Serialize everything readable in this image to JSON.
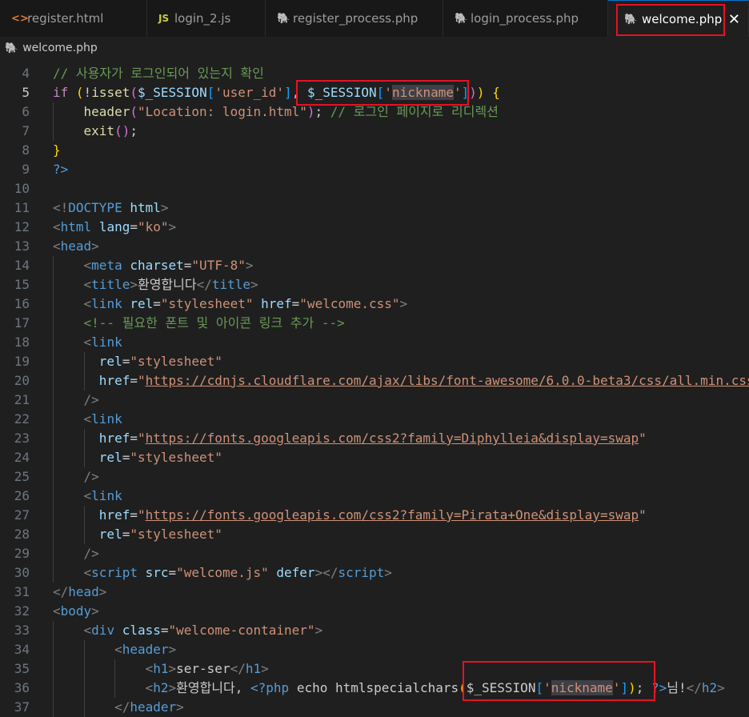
{
  "tabs": [
    {
      "label": "register.html",
      "icon": "html-file-icon",
      "icon_glyph": "<>",
      "icon_color": "#e37933",
      "active": false
    },
    {
      "label": "login_2.js",
      "icon": "js-file-icon",
      "icon_glyph": "JS",
      "icon_color": "#cbcb41",
      "active": false
    },
    {
      "label": "register_process.php",
      "icon": "php-elephant-icon",
      "icon_glyph": "🐘",
      "icon_color": "#a074c4",
      "active": false
    },
    {
      "label": "login_process.php",
      "icon": "php-elephant-icon",
      "icon_glyph": "🐘",
      "icon_color": "#a074c4",
      "active": false
    },
    {
      "label": "welcome.php",
      "icon": "php-elephant-icon",
      "icon_glyph": "🐘",
      "icon_color": "#a074c4",
      "active": true,
      "close": "✕"
    }
  ],
  "breadcrumb": {
    "icon": "php-elephant-icon",
    "icon_glyph": "🐘",
    "file": "welcome.php"
  },
  "editor": {
    "active_line": 5,
    "lines": [
      {
        "n": "4",
        "tokens": [
          [
            "// 사용자가 로그인되어 있는지 확인",
            "cmt"
          ]
        ]
      },
      {
        "n": "5",
        "tokens": [
          [
            "if",
            "kw"
          ],
          [
            " ",
            "txt"
          ],
          [
            "(",
            "b1"
          ],
          [
            "!",
            "txt"
          ],
          [
            "isset",
            "fn"
          ],
          [
            "(",
            "b2"
          ],
          [
            "$_SESSION",
            "var"
          ],
          [
            "[",
            "b3"
          ],
          [
            "'user_id'",
            "str"
          ],
          [
            "]",
            "b3"
          ],
          [
            ", ",
            "txt"
          ],
          [
            "$_SESSION",
            "var"
          ],
          [
            "[",
            "b3"
          ],
          [
            "'",
            "str"
          ],
          [
            "nickname",
            "str-sel"
          ],
          [
            "'",
            "str"
          ],
          [
            "]",
            "b3"
          ],
          [
            ")",
            "b2"
          ],
          [
            ")",
            "b1"
          ],
          [
            " ",
            "txt"
          ],
          [
            "{",
            "b1"
          ]
        ]
      },
      {
        "n": "6",
        "tokens": [
          [
            "    ",
            "txt"
          ],
          [
            "header",
            "fn"
          ],
          [
            "(",
            "b2"
          ],
          [
            "\"Location: login.html\"",
            "str"
          ],
          [
            ")",
            "b2"
          ],
          [
            "; ",
            "txt"
          ],
          [
            "// 로그인 페이지로 리디렉션",
            "cmt"
          ]
        ]
      },
      {
        "n": "7",
        "tokens": [
          [
            "    ",
            "txt"
          ],
          [
            "exit",
            "fn"
          ],
          [
            "()",
            "b2"
          ],
          [
            ";",
            "txt"
          ]
        ]
      },
      {
        "n": "8",
        "tokens": [
          [
            "}",
            "b1"
          ]
        ]
      },
      {
        "n": "9",
        "tokens": [
          [
            "?>",
            "tag"
          ]
        ]
      },
      {
        "n": "10",
        "tokens": []
      },
      {
        "n": "11",
        "tokens": [
          [
            "<!",
            "pun"
          ],
          [
            "DOCTYPE",
            "tag"
          ],
          [
            " ",
            "txt"
          ],
          [
            "html",
            "attr"
          ],
          [
            ">",
            "pun"
          ]
        ]
      },
      {
        "n": "12",
        "tokens": [
          [
            "<",
            "pun"
          ],
          [
            "html",
            "tag"
          ],
          [
            " ",
            "txt"
          ],
          [
            "lang",
            "attr"
          ],
          [
            "=",
            "txt"
          ],
          [
            "\"ko\"",
            "str"
          ],
          [
            ">",
            "pun"
          ]
        ]
      },
      {
        "n": "13",
        "tokens": [
          [
            "<",
            "pun"
          ],
          [
            "head",
            "tag"
          ],
          [
            ">",
            "pun"
          ]
        ]
      },
      {
        "n": "14",
        "tokens": [
          [
            "    ",
            "txt"
          ],
          [
            "<",
            "pun"
          ],
          [
            "meta",
            "tag"
          ],
          [
            " ",
            "txt"
          ],
          [
            "charset",
            "attr"
          ],
          [
            "=",
            "txt"
          ],
          [
            "\"UTF-8\"",
            "str"
          ],
          [
            ">",
            "pun"
          ]
        ]
      },
      {
        "n": "15",
        "tokens": [
          [
            "    ",
            "txt"
          ],
          [
            "<",
            "pun"
          ],
          [
            "title",
            "tag"
          ],
          [
            ">",
            "pun"
          ],
          [
            "환영합니다",
            "txt"
          ],
          [
            "</",
            "pun"
          ],
          [
            "title",
            "tag"
          ],
          [
            ">",
            "pun"
          ]
        ]
      },
      {
        "n": "16",
        "tokens": [
          [
            "    ",
            "txt"
          ],
          [
            "<",
            "pun"
          ],
          [
            "link",
            "tag"
          ],
          [
            " ",
            "txt"
          ],
          [
            "rel",
            "attr"
          ],
          [
            "=",
            "txt"
          ],
          [
            "\"stylesheet\"",
            "str"
          ],
          [
            " ",
            "txt"
          ],
          [
            "href",
            "attr"
          ],
          [
            "=",
            "txt"
          ],
          [
            "\"welcome.css\"",
            "str"
          ],
          [
            ">",
            "pun"
          ]
        ]
      },
      {
        "n": "17",
        "tokens": [
          [
            "    ",
            "txt"
          ],
          [
            "<!-- 필요한 폰트 및 아이콘 링크 추가 -->",
            "cmt"
          ]
        ]
      },
      {
        "n": "18",
        "tokens": [
          [
            "    ",
            "txt"
          ],
          [
            "<",
            "pun"
          ],
          [
            "link",
            "tag"
          ]
        ]
      },
      {
        "n": "19",
        "tokens": [
          [
            "      ",
            "txt"
          ],
          [
            "rel",
            "attr"
          ],
          [
            "=",
            "txt"
          ],
          [
            "\"stylesheet\"",
            "str"
          ]
        ]
      },
      {
        "n": "20",
        "tokens": [
          [
            "      ",
            "txt"
          ],
          [
            "href",
            "attr"
          ],
          [
            "=",
            "txt"
          ],
          [
            "\"",
            "str"
          ],
          [
            "https://cdnjs.cloudflare.com/ajax/libs/font-awesome/6.0.0-beta3/css/all.min.css",
            "link"
          ]
        ]
      },
      {
        "n": "21",
        "tokens": [
          [
            "    ",
            "txt"
          ],
          [
            "/>",
            "pun"
          ]
        ]
      },
      {
        "n": "22",
        "tokens": [
          [
            "    ",
            "txt"
          ],
          [
            "<",
            "pun"
          ],
          [
            "link",
            "tag"
          ]
        ]
      },
      {
        "n": "23",
        "tokens": [
          [
            "      ",
            "txt"
          ],
          [
            "href",
            "attr"
          ],
          [
            "=",
            "txt"
          ],
          [
            "\"",
            "str"
          ],
          [
            "https://fonts.googleapis.com/css2?family=Diphylleia&display=swap",
            "link"
          ],
          [
            "\"",
            "str"
          ]
        ]
      },
      {
        "n": "24",
        "tokens": [
          [
            "      ",
            "txt"
          ],
          [
            "rel",
            "attr"
          ],
          [
            "=",
            "txt"
          ],
          [
            "\"stylesheet\"",
            "str"
          ]
        ]
      },
      {
        "n": "25",
        "tokens": [
          [
            "    ",
            "txt"
          ],
          [
            "/>",
            "pun"
          ]
        ]
      },
      {
        "n": "26",
        "tokens": [
          [
            "    ",
            "txt"
          ],
          [
            "<",
            "pun"
          ],
          [
            "link",
            "tag"
          ]
        ]
      },
      {
        "n": "27",
        "tokens": [
          [
            "      ",
            "txt"
          ],
          [
            "href",
            "attr"
          ],
          [
            "=",
            "txt"
          ],
          [
            "\"",
            "str"
          ],
          [
            "https://fonts.googleapis.com/css2?family=Pirata+One&display=swap",
            "link"
          ],
          [
            "\"",
            "str"
          ]
        ]
      },
      {
        "n": "28",
        "tokens": [
          [
            "      ",
            "txt"
          ],
          [
            "rel",
            "attr"
          ],
          [
            "=",
            "txt"
          ],
          [
            "\"stylesheet\"",
            "str"
          ]
        ]
      },
      {
        "n": "29",
        "tokens": [
          [
            "    ",
            "txt"
          ],
          [
            "/>",
            "pun"
          ]
        ]
      },
      {
        "n": "30",
        "tokens": [
          [
            "    ",
            "txt"
          ],
          [
            "<",
            "pun"
          ],
          [
            "script",
            "tag"
          ],
          [
            " ",
            "txt"
          ],
          [
            "src",
            "attr"
          ],
          [
            "=",
            "txt"
          ],
          [
            "\"welcome.js\"",
            "str"
          ],
          [
            " ",
            "txt"
          ],
          [
            "defer",
            "attr"
          ],
          [
            "></",
            "pun"
          ],
          [
            "script",
            "tag"
          ],
          [
            ">",
            "pun"
          ]
        ]
      },
      {
        "n": "31",
        "tokens": [
          [
            "</",
            "pun"
          ],
          [
            "head",
            "tag"
          ],
          [
            ">",
            "pun"
          ]
        ]
      },
      {
        "n": "32",
        "tokens": [
          [
            "<",
            "pun"
          ],
          [
            "body",
            "tag"
          ],
          [
            ">",
            "pun"
          ]
        ]
      },
      {
        "n": "33",
        "tokens": [
          [
            "    ",
            "txt"
          ],
          [
            "<",
            "pun"
          ],
          [
            "div",
            "tag"
          ],
          [
            " ",
            "txt"
          ],
          [
            "class",
            "attr"
          ],
          [
            "=",
            "txt"
          ],
          [
            "\"welcome-container\"",
            "str"
          ],
          [
            ">",
            "pun"
          ]
        ]
      },
      {
        "n": "34",
        "tokens": [
          [
            "        ",
            "txt"
          ],
          [
            "<",
            "pun"
          ],
          [
            "header",
            "tag"
          ],
          [
            ">",
            "pun"
          ]
        ]
      },
      {
        "n": "35",
        "tokens": [
          [
            "            ",
            "txt"
          ],
          [
            "<",
            "pun"
          ],
          [
            "h1",
            "tag"
          ],
          [
            ">",
            "pun"
          ],
          [
            "ser-ser",
            "txt"
          ],
          [
            "</",
            "pun"
          ],
          [
            "h1",
            "tag"
          ],
          [
            ">",
            "pun"
          ]
        ]
      },
      {
        "n": "36",
        "tokens": [
          [
            "            ",
            "txt"
          ],
          [
            "<",
            "pun"
          ],
          [
            "h2",
            "tag"
          ],
          [
            ">",
            "pun"
          ],
          [
            "환영합니다, ",
            "txt"
          ],
          [
            "<?php",
            "tag"
          ],
          [
            " echo htmlspecialchars",
            "txt"
          ],
          [
            "(",
            "b1"
          ],
          [
            "$_SESSION",
            "txt"
          ],
          [
            "[",
            "b3"
          ],
          [
            "'",
            "str"
          ],
          [
            "nickname",
            "str-sel"
          ],
          [
            "'",
            "str"
          ],
          [
            "]",
            "b3"
          ],
          [
            ")",
            "b1"
          ],
          [
            "; ",
            "txt"
          ],
          [
            "?>",
            "tag"
          ],
          [
            "님!",
            "txt"
          ],
          [
            "</",
            "pun"
          ],
          [
            "h2",
            "tag"
          ],
          [
            ">",
            "pun"
          ]
        ]
      },
      {
        "n": "37",
        "tokens": [
          [
            "        ",
            "txt"
          ],
          [
            "</",
            "pun"
          ],
          [
            "header",
            "tag"
          ],
          [
            ">",
            "pun"
          ]
        ]
      }
    ]
  }
}
